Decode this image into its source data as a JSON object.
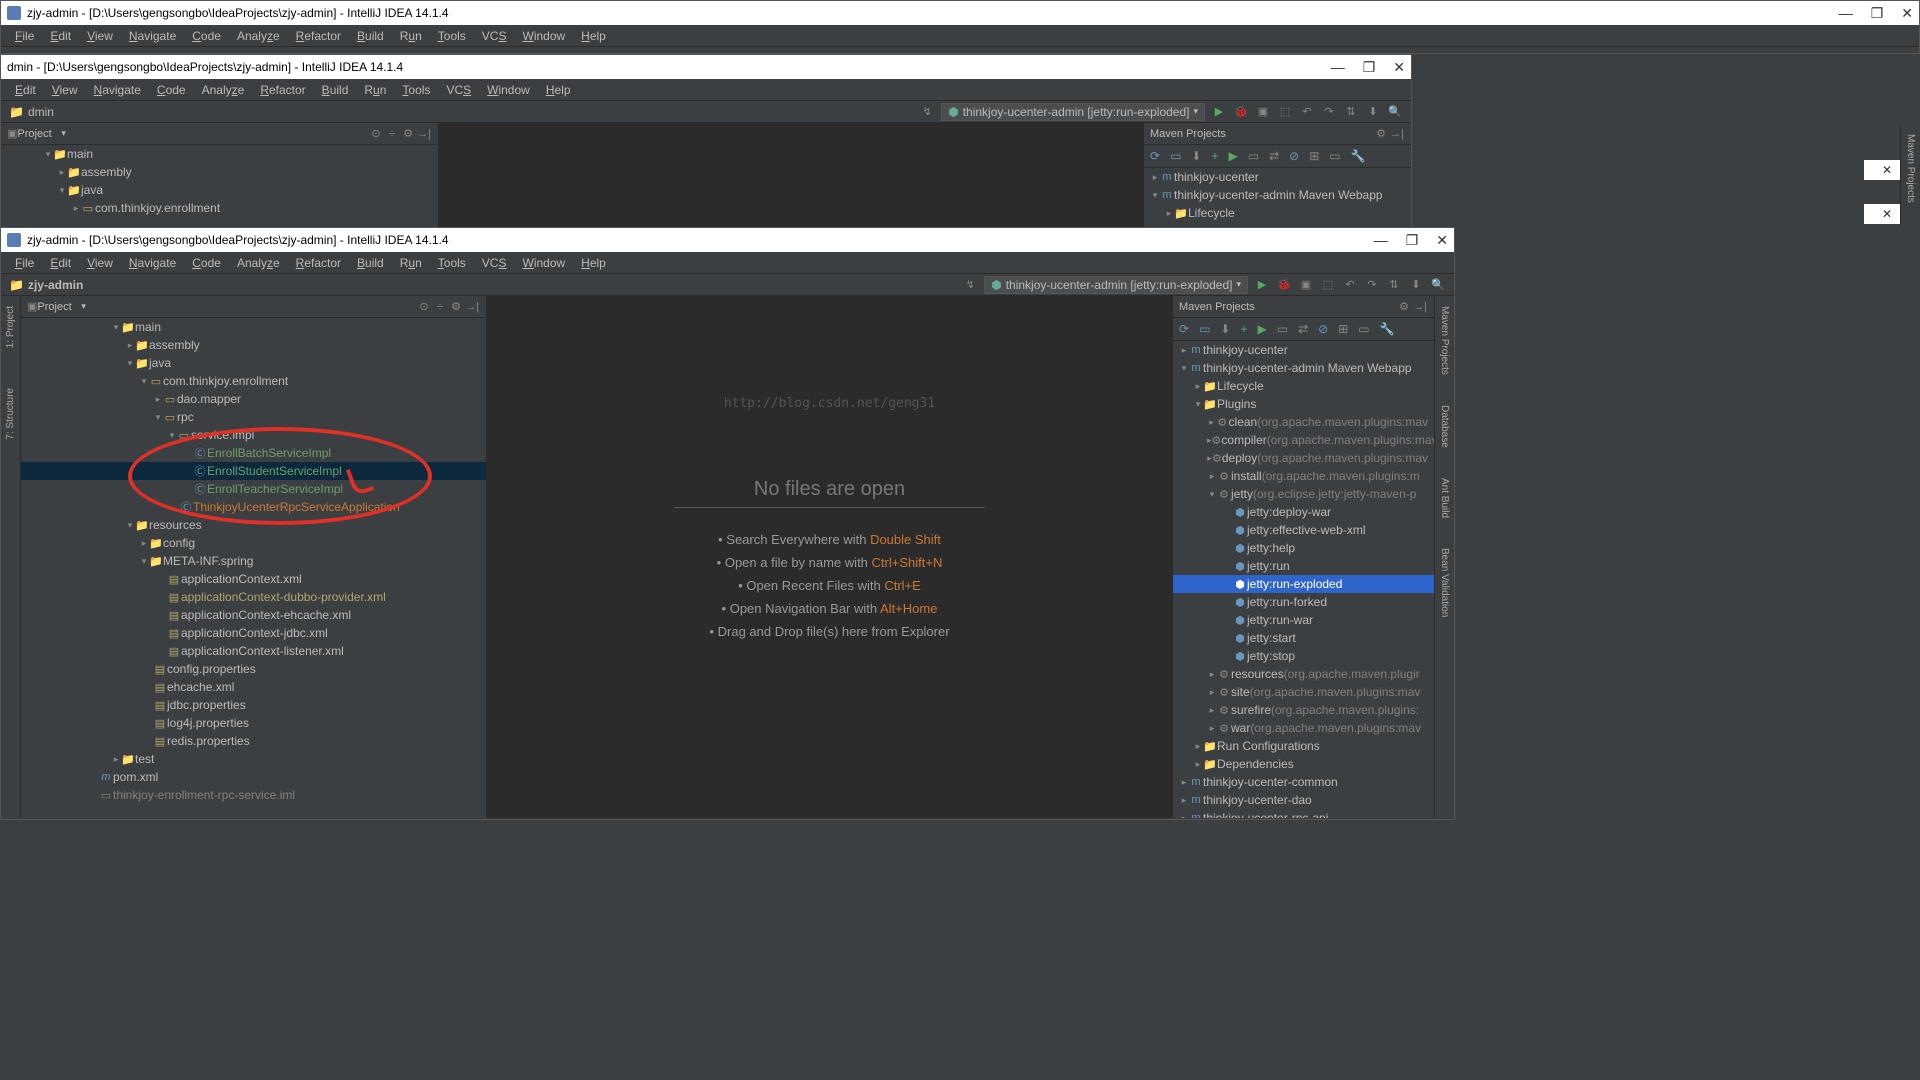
{
  "app_title": "zjy-admin - [D:\\Users\\gengsongbo\\IdeaProjects\\zjy-admin] - IntelliJ IDEA 14.1.4",
  "app_title_partial": "dmin - [D:\\Users\\gengsongbo\\IdeaProjects\\zjy-admin] - IntelliJ IDEA 14.1.4",
  "menu": {
    "file": "File",
    "edit": "Edit",
    "view": "View",
    "navigate": "Navigate",
    "code": "Code",
    "analyze": "Analyze",
    "refactor": "Refactor",
    "build": "Build",
    "run": "Run",
    "tools": "Tools",
    "vcs": "VCS",
    "window": "Window",
    "help": "Help"
  },
  "breadcrumb_root": "zjy-admin",
  "breadcrumb_partial": "dmin",
  "run_config": "thinkjoy-ucenter-admin [jetty:run-exploded]",
  "project_panel_title": "Project",
  "maven_panel_title": "Maven Projects",
  "watermark_url": "http://blog.csdn.net/geng31",
  "editor_empty": {
    "title": "No files are open",
    "l1a": "Search Everywhere with ",
    "l1b": "Double Shift",
    "l2a": "Open a file by name with ",
    "l2b": "Ctrl+Shift+N",
    "l3a": "Open Recent Files with ",
    "l3b": "Ctrl+E",
    "l4a": "Open Navigation Bar with ",
    "l4b": "Alt+Home",
    "l5": "Drag and Drop file(s) here from Explorer"
  },
  "tree_top": {
    "main": "main",
    "assembly": "assembly",
    "java": "java",
    "pkg": "com.thinkjoy.enrollment"
  },
  "tree_bottom": {
    "main": "main",
    "assembly": "assembly",
    "java": "java",
    "pkg": "com.thinkjoy.enrollment",
    "daomapper": "dao.mapper",
    "rpc": "rpc",
    "serviceimpl": "service.impl",
    "s1": "EnrollBatchServiceImpl",
    "s2": "EnrollStudentServiceImpl",
    "s3": "EnrollTeacherServiceImpl",
    "app": "ThinkjoyUcenterRpcServiceApplication",
    "resources": "resources",
    "config": "config",
    "metainf": "META-INF.spring",
    "ac1": "applicationContext.xml",
    "ac2": "applicationContext-dubbo-provider.xml",
    "ac3": "applicationContext-ehcache.xml",
    "ac4": "applicationContext-jdbc.xml",
    "ac5": "applicationContext-listener.xml",
    "p1": "config.properties",
    "p2": "ehcache.xml",
    "p3": "jdbc.properties",
    "p4": "log4j.properties",
    "p5": "redis.properties",
    "test": "test",
    "pom": "pom.xml",
    "iml": "thinkjoy-enrollment-rpc-service.iml"
  },
  "maven": {
    "m1": "thinkjoy-ucenter",
    "m2": "thinkjoy-ucenter-admin Maven Webapp",
    "lifecycle": "Lifecycle",
    "plugins": "Plugins",
    "clean": "clean",
    "compiler": "compiler",
    "deploy": "deploy",
    "install": "install",
    "jetty": "jetty",
    "cleansfx": " (org.apache.maven.plugins:mav",
    "compilersfx": " (org.apache.maven.plugins:mav",
    "deploysfx": " (org.apache.maven.plugins:mav",
    "installsfx": " (org.apache.maven.plugins:m",
    "jettysfx": " (org.eclipse.jetty:jetty-maven-p",
    "jdeploy": "jetty:deploy-war",
    "jeff": "jetty:effective-web-xml",
    "jhelp": "jetty:help",
    "jrun": "jetty:run",
    "jrunexp": "jetty:run-exploded",
    "jrunfork": "jetty:run-forked",
    "jrunwar": "jetty:run-war",
    "jstart": "jetty:start",
    "jstop": "jetty:stop",
    "resources": "resources",
    "site": "site",
    "surefire": "surefire",
    "war": "war",
    "ressfx": " (org.apache.maven.plugir",
    "sitesfx": " (org.apache.maven.plugins:mav",
    "suresfx": " (org.apache.maven.plugins:",
    "warsfx": " (org.apache.maven.plugins:mav",
    "runcfg": "Run Configurations",
    "deps": "Dependencies",
    "mcommon": "thinkjoy-ucenter-common",
    "mdao": "thinkjoy-ucenter-dao",
    "mrpcapi": "thinkjoy-ucenter-rpc-api"
  },
  "sidebar": {
    "proj": "1: Project",
    "struct": "7: Structure",
    "mvnp": "Maven Projects",
    "db": "Database",
    "ant": "Ant Build",
    "bv": "Bean Validation"
  }
}
